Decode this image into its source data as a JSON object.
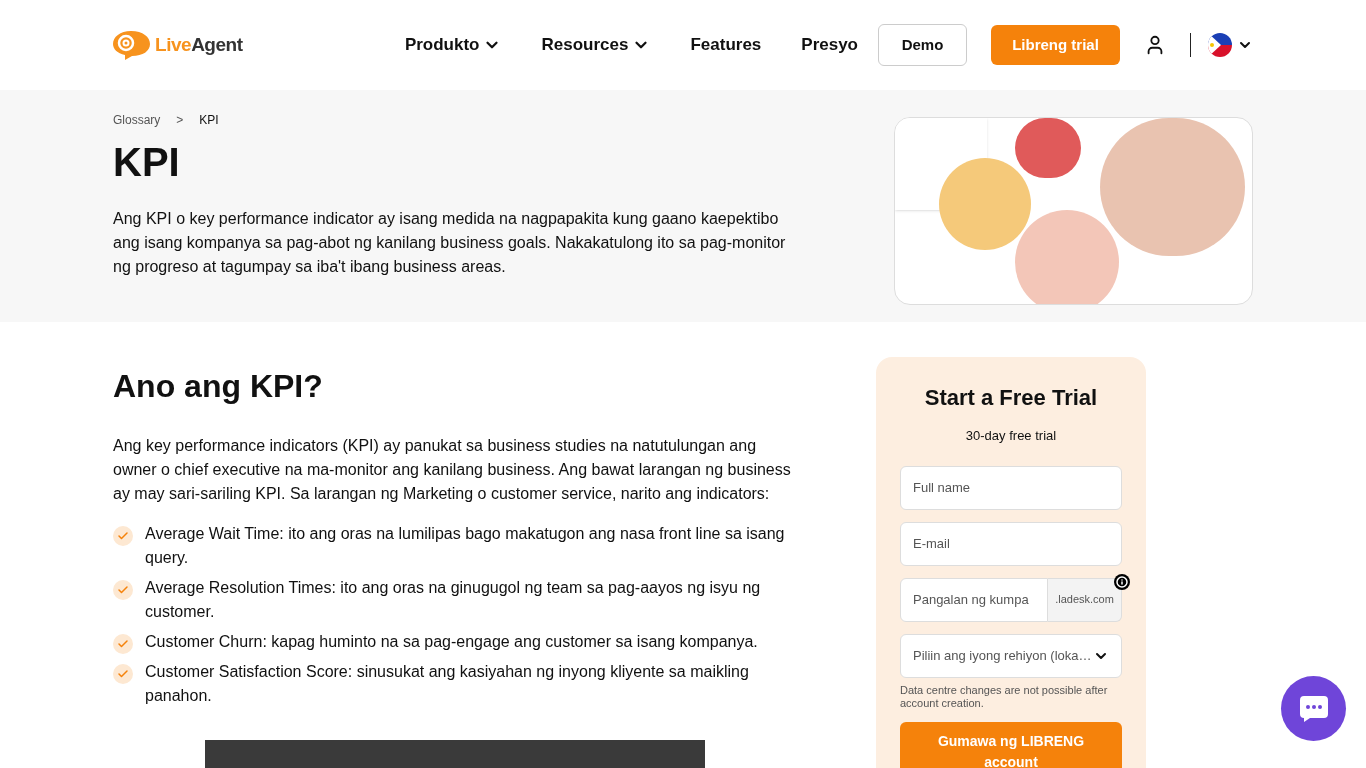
{
  "header": {
    "logo": {
      "part_1": "Live",
      "part_2": "Agent"
    },
    "nav": [
      {
        "label": "Produkto",
        "dropdown": true
      },
      {
        "label": "Resources",
        "dropdown": true
      },
      {
        "label": "Features",
        "dropdown": false
      },
      {
        "label": "Presyo",
        "dropdown": false
      }
    ],
    "demo_button": "Demo",
    "trial_button": "Libreng trial"
  },
  "hero": {
    "breadcrumb": [
      "Glossary",
      "KPI"
    ],
    "separator": ">",
    "title": "KPI",
    "intro": "Ang KPI o key performance indicator ay isang medida na nagpapakita kung gaano kaepektibo ang isang kompanya sa pag-abot ng kanilang business goals. Nakakatulong ito sa pag-monitor ng progreso at tagumpay sa iba't ibang business areas."
  },
  "article": {
    "heading": "Ano ang KPI?",
    "paragraph": "Ang key performance indicators (KPI) ay panukat sa business studies na natutulungan ang owner o chief executive na ma-monitor ang kanilang business. Ang bawat larangan ng business ay may sari-sariling KPI. Sa larangan ng Marketing o customer service, narito ang indicators:",
    "bullets": [
      "Average Wait Time: ito ang oras na lumilipas bago makatugon ang nasa front line sa isang query.",
      "Average Resolution Times: ito ang oras na ginugugol ng team sa pag-aayos ng isyu ng customer.",
      "Customer Churn: kapag huminto na sa pag-engage ang customer sa isang kompanya.",
      "Customer Satisfaction Score: sinusukat ang kasiyahan ng inyong kliyente sa maikling panahon."
    ]
  },
  "trial_form": {
    "title": "Start a Free Trial",
    "subtitle": "30-day free trial",
    "fields": [
      {
        "kind": "text",
        "placeholder": "Full name"
      },
      {
        "kind": "text",
        "placeholder": "E-mail"
      },
      {
        "kind": "domain",
        "placeholder": "Pangalan ng kumpa",
        "suffix": ".ladesk.com"
      },
      {
        "kind": "select",
        "value": "Piliin ang iyong rehiyon (loka…"
      }
    ],
    "note": "Data centre changes are not possible after account creation.",
    "submit": "Gumawa ng LIBRENG account"
  }
}
